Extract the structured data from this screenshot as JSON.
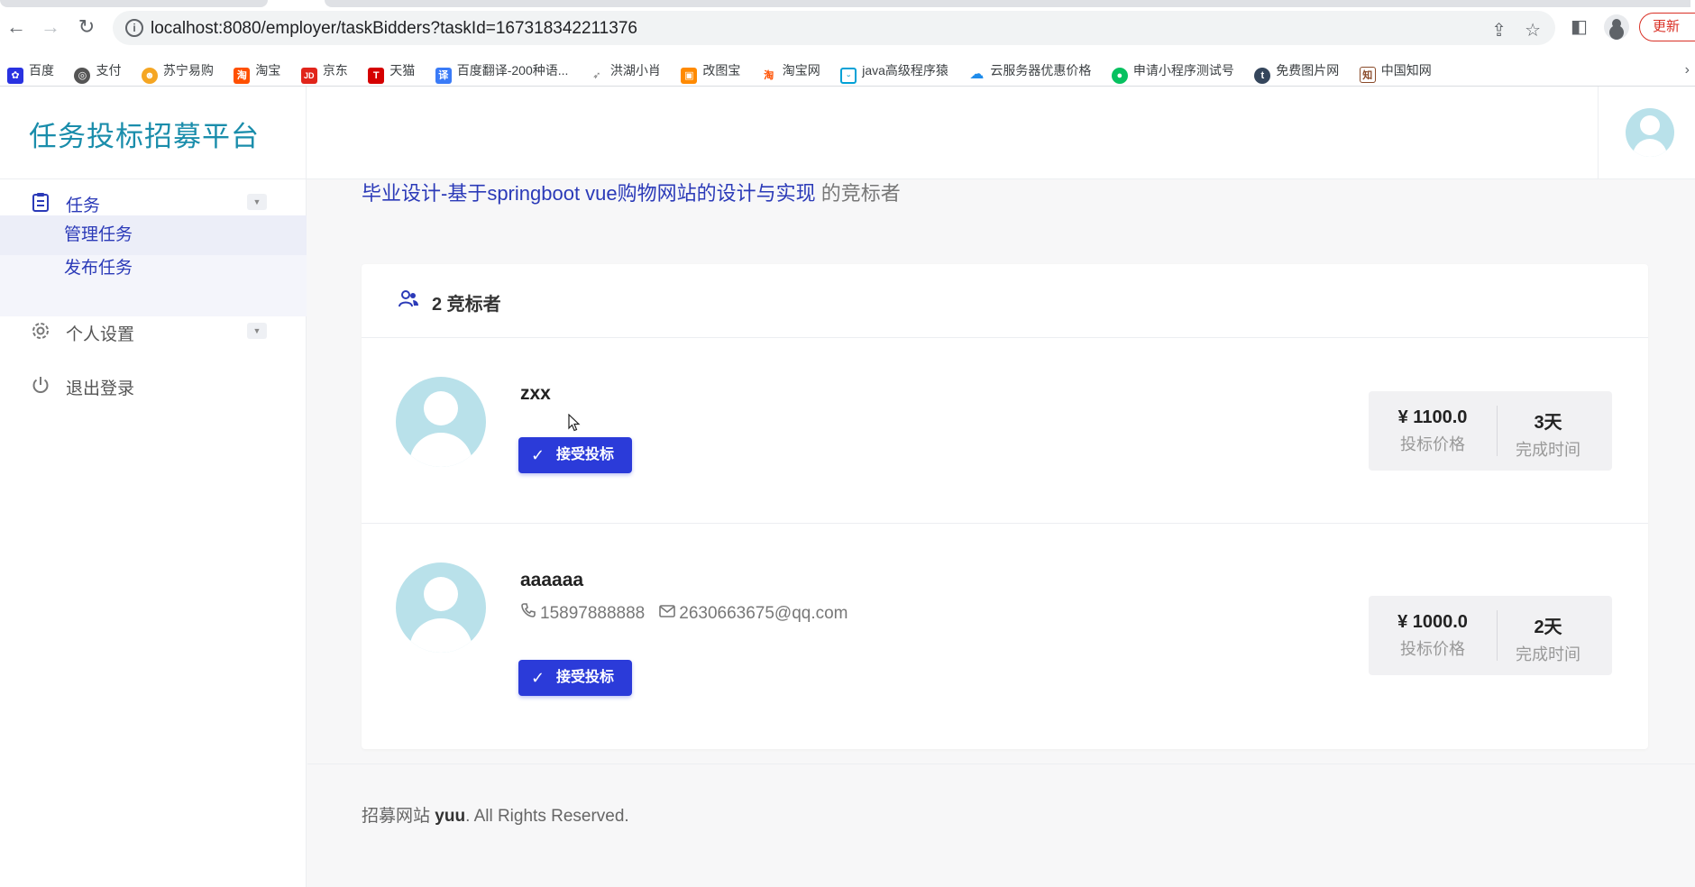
{
  "browser": {
    "url": "localhost:8080/employer/taskBidders?taskId=167318342211376",
    "update_label": "更新",
    "bookmarks": [
      {
        "label": "百度",
        "icon": "baidu-paw-icon",
        "color": "#2932e1"
      },
      {
        "label": "支付",
        "icon": "globe-icon",
        "color": "#555555"
      },
      {
        "label": "苏宁易购",
        "icon": "suning-icon",
        "color": "#f5a623"
      },
      {
        "label": "淘宝",
        "icon": "taobao-icon",
        "color": "#ff5000"
      },
      {
        "label": "京东",
        "icon": "jd-icon",
        "color": "#e1251b"
      },
      {
        "label": "天猫",
        "icon": "tmall-icon",
        "color": "#d50000"
      },
      {
        "label": "百度翻译-200种语...",
        "icon": "translate-icon",
        "color": "#3a7bf7"
      },
      {
        "label": "洪湖小肖",
        "icon": "bird-icon",
        "color": "#777777"
      },
      {
        "label": "改图宝",
        "icon": "gaitubao-icon",
        "color": "#ff8a00"
      },
      {
        "label": "淘宝网",
        "icon": "taobao-icon",
        "color": "#ff5000"
      },
      {
        "label": "java高级程序猿",
        "icon": "bilibili-tv-icon",
        "color": "#00a1d6"
      },
      {
        "label": "云服务器优惠价格",
        "icon": "cloud-icon",
        "color": "#1f8ceb"
      },
      {
        "label": "申请小程序测试号",
        "icon": "wechat-icon",
        "color": "#07c160"
      },
      {
        "label": "免费图片网",
        "icon": "t-icon",
        "color": "#35465c"
      },
      {
        "label": "中国知网",
        "icon": "cnki-icon",
        "color": "#8a4b2a"
      }
    ]
  },
  "app": {
    "brand": "任务投标招募平台",
    "sidebar": {
      "task_label": "任务",
      "task_submenu": [
        "管理任务",
        "发布任务"
      ],
      "settings_label": "个人设置",
      "logout_label": "退出登录"
    },
    "heading": {
      "task_title": "毕业设计-基于springboot vue购物网站的设计与实现",
      "suffix": " 的竞标者"
    },
    "card_title": "2 竞标者",
    "bidders": [
      {
        "name": "zxx",
        "accept_label": "接受投标",
        "price": "¥ 1100.0",
        "price_label": "投标价格",
        "days": "3天",
        "days_label": "完成时间"
      },
      {
        "name": "aaaaaa",
        "phone": "15897888888",
        "email": "2630663675@qq.com",
        "accept_label": "接受投标",
        "price": "¥ 1000.0",
        "price_label": "投标价格",
        "days": "2天",
        "days_label": "完成时间"
      }
    ],
    "footer": {
      "prefix": "招募网站 ",
      "brand": "yuu",
      "suffix": ". All Rights Reserved."
    }
  },
  "colors": {
    "accent": "#2b3ab8",
    "button": "#2b3bd9",
    "brand": "#1a8dab",
    "avatar": "#b9e1ea"
  }
}
